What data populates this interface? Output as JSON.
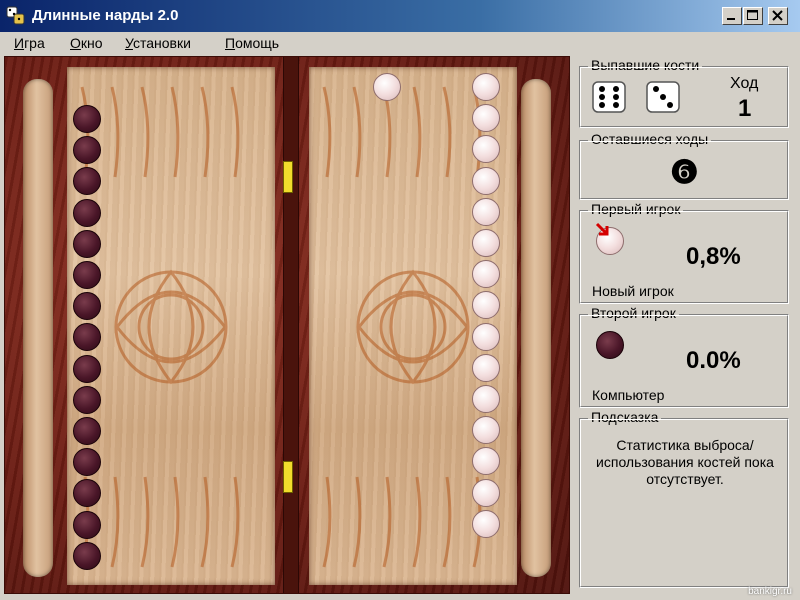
{
  "window": {
    "title": "Длинные нарды 2.0",
    "controls": [
      "minimize",
      "maximize",
      "close"
    ]
  },
  "menu": [
    "Игра",
    "Окно",
    "Установки",
    "Помощь"
  ],
  "board": {
    "left_column_dark_checkers": 15,
    "right_column_light_checkers": 15,
    "extra_light_checker": 1
  },
  "panel": {
    "dice": {
      "title": "Выпавшие кости",
      "die1": 6,
      "die2": 3,
      "move_label": "Ход",
      "move_value": "1"
    },
    "remaining": {
      "title": "Оставшиеся ходы",
      "value": "❻"
    },
    "player1": {
      "title": "Первый игрок",
      "percent": "0,8%",
      "name": "Новый игрок"
    },
    "player2": {
      "title": "Второй игрок",
      "percent": "0.0%",
      "name": "Компьютер"
    },
    "hint": {
      "title": "Подсказка",
      "text": "Статистика выброса/использования костей пока отсутствует."
    }
  },
  "watermark": "bankigr.ru"
}
